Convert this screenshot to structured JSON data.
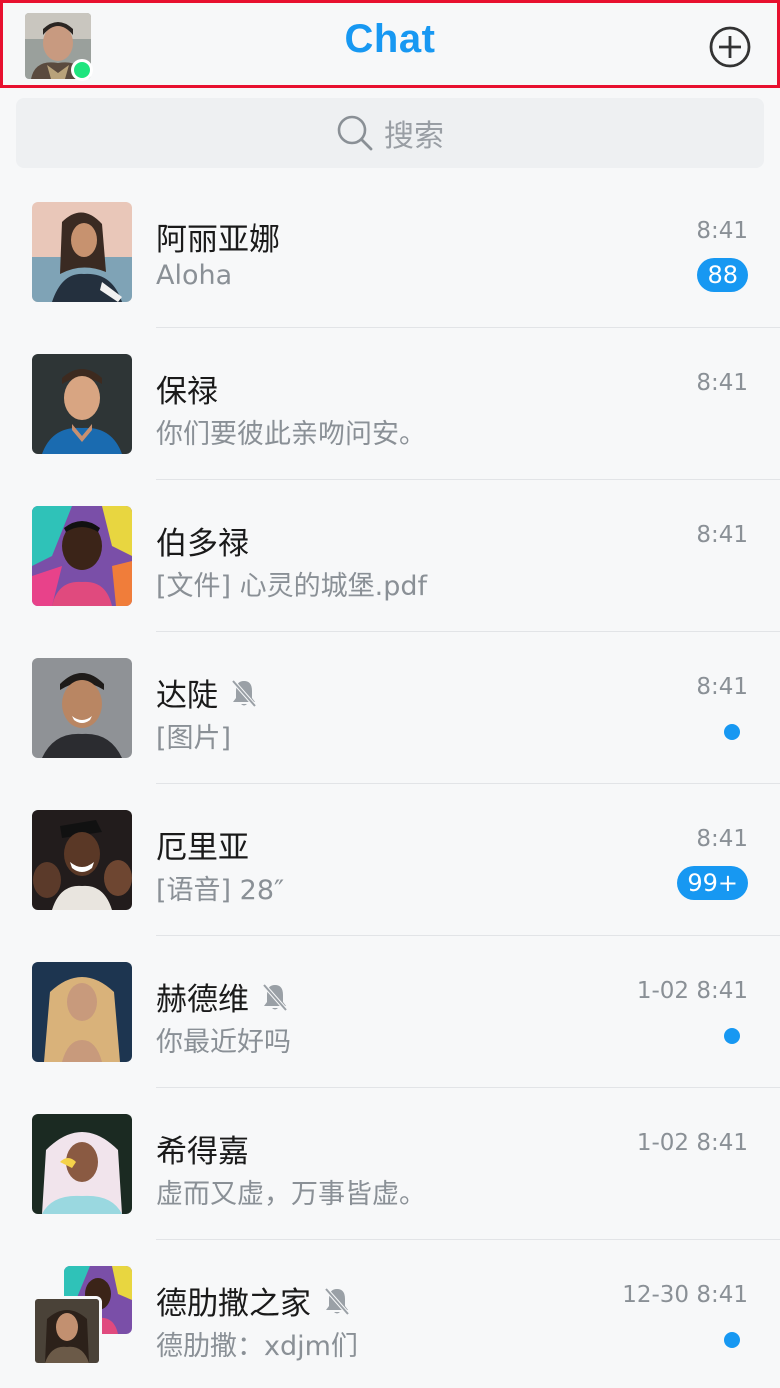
{
  "header": {
    "title": "Chat"
  },
  "search": {
    "placeholder": "搜索"
  },
  "conversations": [
    {
      "name": "阿丽亚娜",
      "preview": "Aloha",
      "time": "8:41",
      "badge": "88",
      "muted": false
    },
    {
      "name": "保禄",
      "preview": "你们要彼此亲吻问安。",
      "time": "8:41",
      "badge": "",
      "muted": false
    },
    {
      "name": "伯多禄",
      "preview": "[文件] 心灵的城堡.pdf",
      "time": "8:41",
      "badge": "",
      "muted": false
    },
    {
      "name": "达陡",
      "preview": "[图片]",
      "time": "8:41",
      "badge": "",
      "muted": true,
      "unread_dot": true
    },
    {
      "name": "厄里亚",
      "preview": "[语音] 28″",
      "time": "8:41",
      "badge": "99+",
      "muted": false
    },
    {
      "name": "赫德维",
      "preview": "你最近好吗",
      "time": "1-02 8:41",
      "badge": "",
      "muted": true,
      "unread_dot": true
    },
    {
      "name": "希得嘉",
      "preview": "虚而又虚，万事皆虚。",
      "time": "1-02 8:41",
      "badge": "",
      "muted": false
    },
    {
      "name": "德肋撒之家",
      "preview": "德肋撒：xdjm们",
      "time": "12-30 8:41",
      "badge": "",
      "muted": true,
      "unread_dot": true
    }
  ],
  "colors": {
    "accent": "#1798f2",
    "online": "#1fe57e",
    "header_border": "#e8102f"
  },
  "icons": {
    "add": "plus-circle-icon",
    "search": "search-icon",
    "mute": "bell-off-icon"
  }
}
